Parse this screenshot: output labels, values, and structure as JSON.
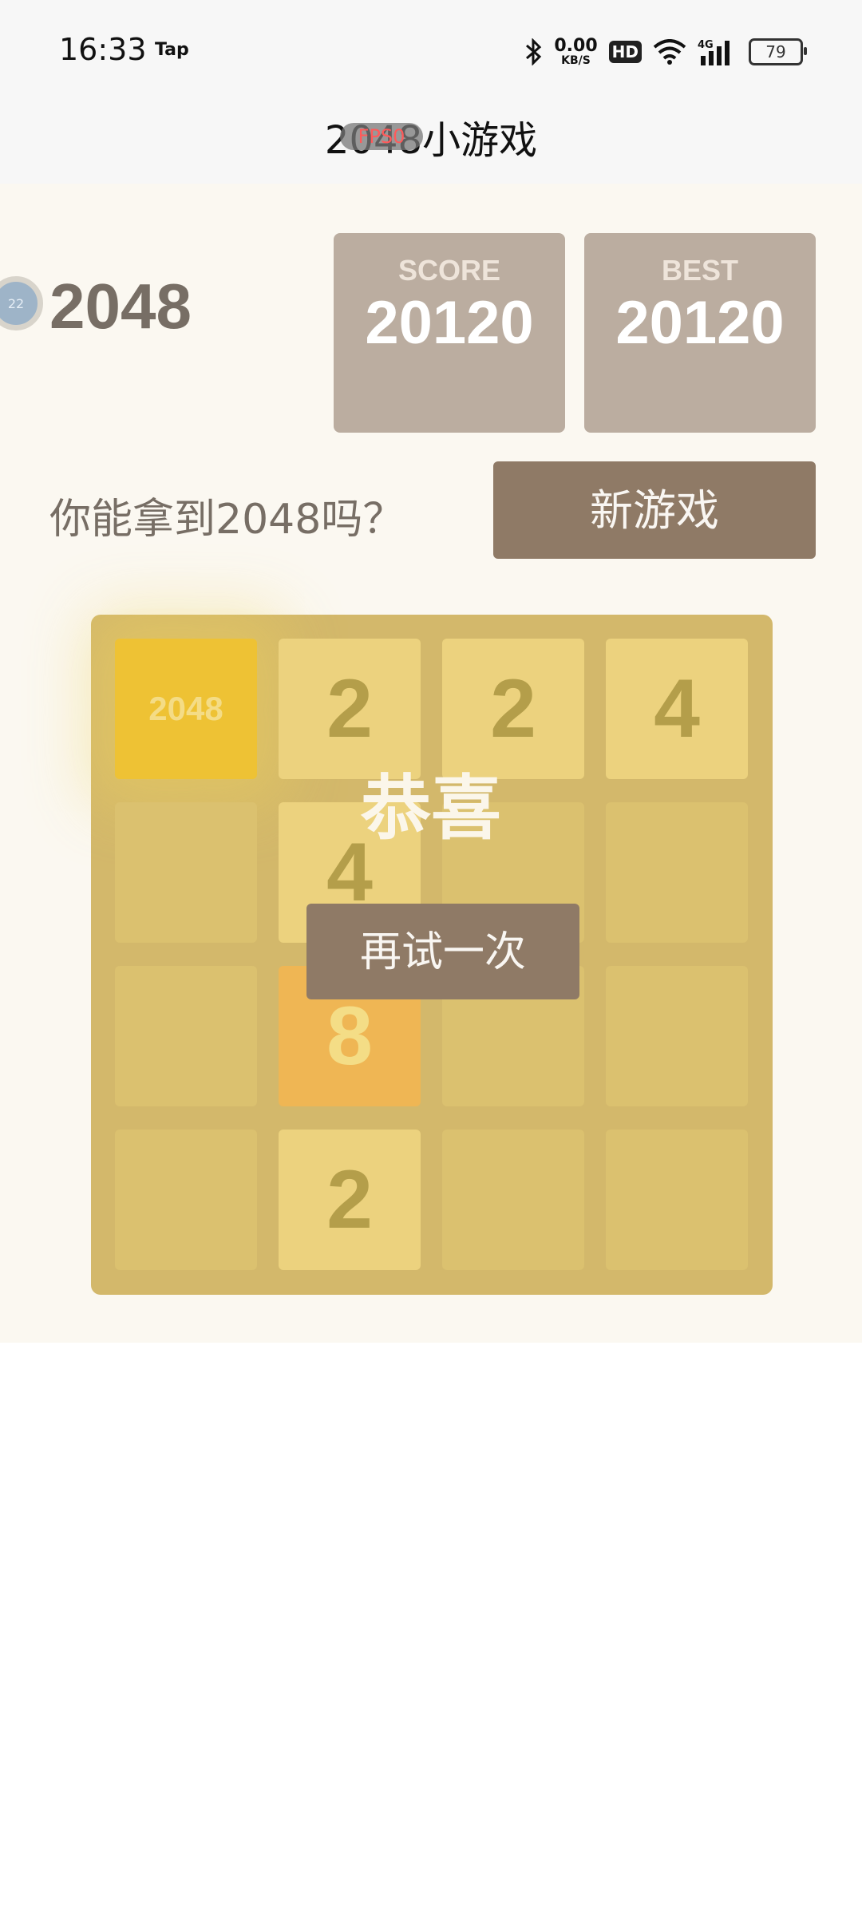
{
  "status_bar": {
    "time": "16:33",
    "tap_label": "Tap",
    "net_speed_value": "0.00",
    "net_speed_unit": "KB/S",
    "hd_label": "HD",
    "network_label": "4G",
    "battery": "79"
  },
  "app": {
    "title": "2048小游戏",
    "fps_label": "FPS0"
  },
  "game": {
    "avatar_text": "22",
    "logo": "2048",
    "score_label": "SCORE",
    "score_value": "20120",
    "best_label": "BEST",
    "best_value": "20120",
    "subtitle": "你能拿到2048吗？",
    "new_game_label": "新游戏",
    "overlay_title": "恭喜",
    "retry_label": "再试一次"
  },
  "board": {
    "rows": [
      [
        "2048",
        "2",
        "2",
        "4"
      ],
      [
        "",
        "4",
        "",
        ""
      ],
      [
        "",
        "8",
        "",
        ""
      ],
      [
        "",
        "2",
        "",
        ""
      ]
    ]
  },
  "colors": {
    "board_bg": "#d3b86b",
    "empty_cell": "#dbc16f",
    "tile_2_4": "#ecd27e",
    "tile_8": "#efb654",
    "tile_2048": "#eec234",
    "button": "#8f7a66",
    "score_box": "#bbada0"
  }
}
